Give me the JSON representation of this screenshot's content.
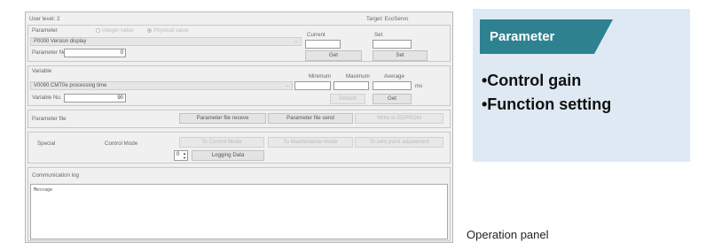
{
  "window": {
    "user_level": "User level: 2",
    "target": "Target: EcoServo"
  },
  "parameter_group": {
    "label": "Parameter",
    "radio_integer": "Integer value",
    "radio_physical": "Physical value",
    "selected": "P0000 Version display",
    "number_label": "Parameter No.",
    "number_value": "0",
    "current_label": "Current",
    "set_label": "Set",
    "get_button": "Get",
    "set_button": "Set"
  },
  "variable_group": {
    "label": "Variable",
    "selected": "V0090 CMT0e processing time",
    "number_label": "Variable No.",
    "number_value": "90",
    "min_label": "Minimum",
    "max_label": "Maximum",
    "avg_label": "Average",
    "unit": "ms",
    "default_button": "Default",
    "get_button": "Get"
  },
  "parameter_file": {
    "label": "Parameter file",
    "receive_button": "Parameter file receve",
    "send_button": "Parameter file send",
    "eeprom_button": "Write to EEPROM"
  },
  "special": {
    "label": "Special",
    "control_mode_label": "Control Mode",
    "to_control_button": "To Control Mode",
    "to_maintenance_button": "To Maintenance mode",
    "zero_point_button": "To zero point adjustment",
    "stepper_value": "0",
    "logging_button": "Logging Data"
  },
  "communication": {
    "label": "Communication log",
    "message": "Message"
  },
  "card": {
    "title": "Parameter",
    "bullets": [
      "•Control gain",
      "•Function setting"
    ]
  },
  "caption": "Operation panel",
  "colors": {
    "accent": "#2e8290",
    "card_bg": "#dfe9f3",
    "window_bg": "#f0f0f0"
  }
}
